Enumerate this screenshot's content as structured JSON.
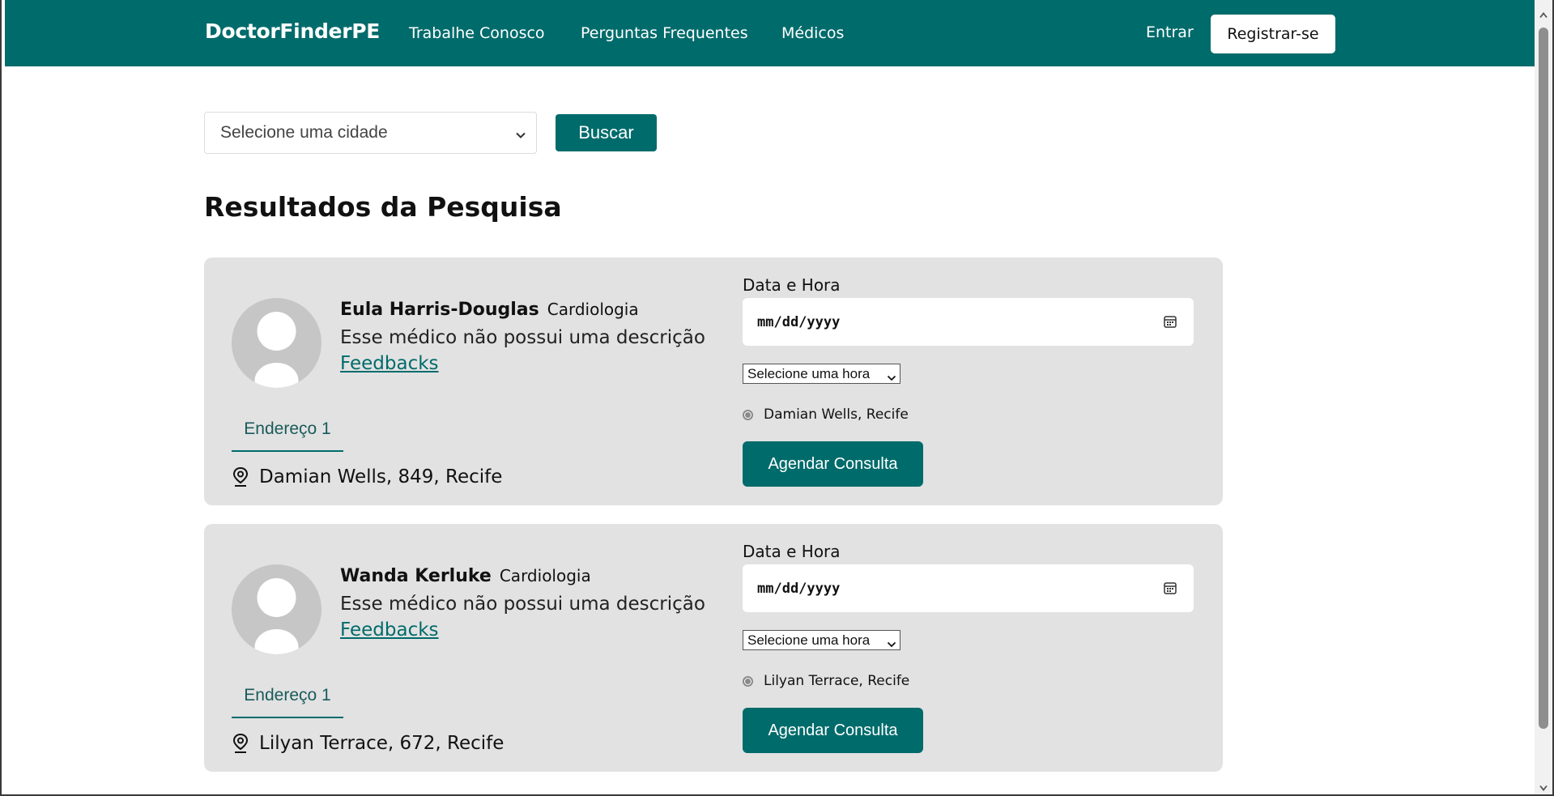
{
  "nav": {
    "brand": "DoctorFinderPE",
    "links": [
      "Trabalhe Conosco",
      "Perguntas Frequentes",
      "Médicos"
    ],
    "login": "Entrar",
    "register": "Registrar-se"
  },
  "search": {
    "city_placeholder": "Selecione uma cidade",
    "button": "Buscar"
  },
  "results": {
    "title": "Resultados da Pesquisa",
    "doctors": [
      {
        "name": "Eula Harris-Douglas",
        "specialty": "Cardiologia",
        "description": "Esse médico não possui uma descrição",
        "feedback_link": "Feedbacks",
        "address_tab": "Endereço 1",
        "address": "Damian Wells, 849, Recife",
        "datetime_label": "Data e Hora",
        "date_placeholder": "mm/dd/yyyy",
        "hour_select": "Selecione uma hora",
        "location_option": "Damian Wells, Recife",
        "book_button": "Agendar Consulta"
      },
      {
        "name": "Wanda Kerluke",
        "specialty": "Cardiologia",
        "description": "Esse médico não possui uma descrição",
        "feedback_link": "Feedbacks",
        "address_tab": "Endereço 1",
        "address": "Lilyan Terrace, 672, Recife",
        "datetime_label": "Data e Hora",
        "date_placeholder": "mm/dd/yyyy",
        "hour_select": "Selecione uma hora",
        "location_option": "Lilyan Terrace, Recife",
        "book_button": "Agendar Consulta"
      }
    ]
  },
  "colors": {
    "primary": "#006b6b",
    "card_bg": "#e2e2e2"
  },
  "icons": [
    "chevron-down-icon",
    "location-pin-icon",
    "calendar-icon",
    "avatar-placeholder-icon"
  ]
}
